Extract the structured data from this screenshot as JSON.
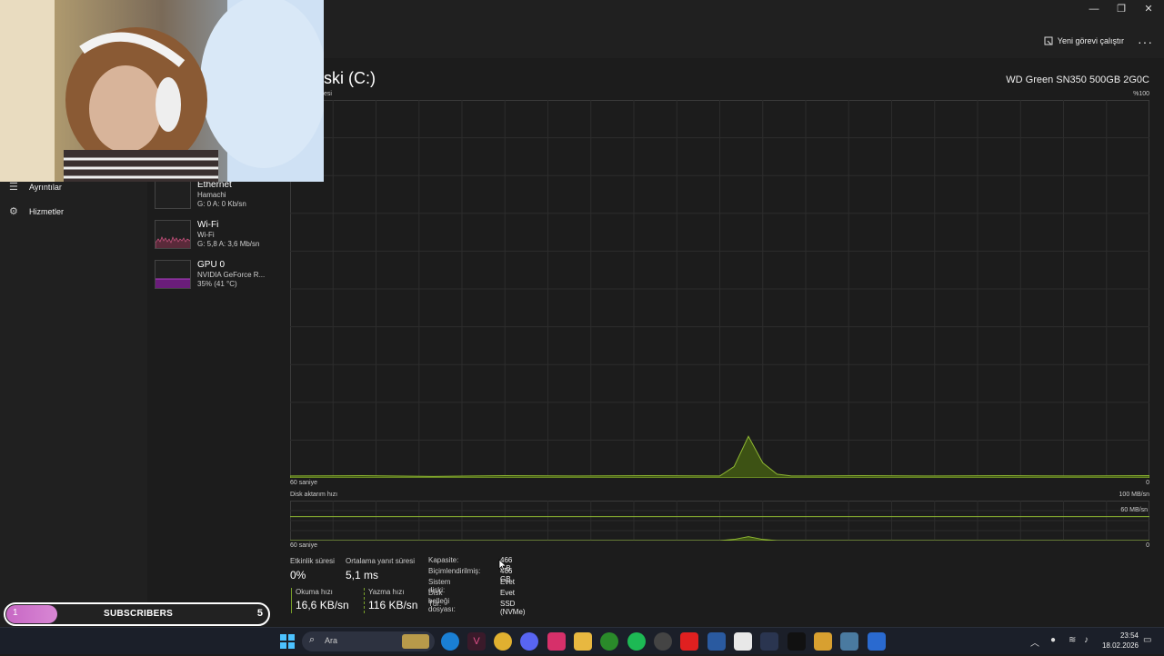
{
  "window": {
    "minimize": "—",
    "maximize": "❐",
    "close": "✕"
  },
  "commandbar": {
    "run_task_label": "Yeni görevi çalıştır",
    "more_label": "···"
  },
  "nav": {
    "items": [
      {
        "label": "Ayrıntılar",
        "icon": "list-icon"
      },
      {
        "label": "Hizmetler",
        "icon": "services-icon"
      }
    ]
  },
  "devices": [
    {
      "name": "Ethernet",
      "sub": "Hamachi",
      "value": "G: 0 A: 0 Kb/sn"
    },
    {
      "name": "Wi-Fi",
      "sub": "Wi-Fi",
      "value": "G: 5,8 A: 3,6 Mb/sn"
    },
    {
      "name": "GPU 0",
      "sub": "NVIDIA GeForce R...",
      "value": "35% (41 °C)"
    }
  ],
  "page": {
    "title": "ski (C:)",
    "model": "WD Green SN350 500GB 2G0C",
    "active_time_label": "esi",
    "max_label": "%100",
    "time_label": "60 saniye",
    "min_label": "0",
    "transfer_label": "Disk aktarım hızı",
    "transfer_max": "100 MB/sn",
    "transfer_line": "60 MB/sn",
    "time_label2": "60 saniye",
    "min_label2": "0"
  },
  "chart_data": [
    {
      "type": "area",
      "title": "",
      "ylabel": "",
      "ylim": [
        0,
        100
      ],
      "x_label": "60 saniye",
      "color": "#8fb832",
      "x": [
        0,
        5,
        10,
        15,
        20,
        25,
        30,
        31,
        32,
        33,
        34,
        35,
        40,
        45,
        50,
        55,
        60
      ],
      "values": [
        0.5,
        0.6,
        0.4,
        0.6,
        0.5,
        0.6,
        0.5,
        3,
        11,
        4,
        1,
        0.5,
        0.6,
        0.5,
        0.6,
        0.5,
        0.6
      ]
    },
    {
      "type": "area",
      "title": "",
      "ylabel": "",
      "ylim": [
        0,
        100
      ],
      "x_label": "60 saniye",
      "color": "#8fb832",
      "reference_line": 60,
      "x": [
        0,
        20,
        30,
        31,
        32,
        33,
        34,
        60
      ],
      "values": [
        0,
        0,
        0,
        3,
        10,
        3,
        0,
        0
      ]
    }
  ],
  "stats": {
    "active_time_label": "Etkinlik süresi",
    "active_time": "0%",
    "avg_response_label": "Ortalama yanıt süresi",
    "avg_response": "5,1 ms",
    "read_label": "Okuma hızı",
    "read_value": "16,6 KB/sn",
    "write_label": "Yazma hızı",
    "write_value": "116 KB/sn"
  },
  "properties": [
    {
      "key": "Kapasite:",
      "value": "466 GB"
    },
    {
      "key": "Biçimlendirilmiş:",
      "value": "466 GB"
    },
    {
      "key": "Sistem diski:",
      "value": "Evet"
    },
    {
      "key": "Disk belleği dosyası:",
      "value": "Evet"
    },
    {
      "key": "Tür:",
      "value": "SSD (NVMe)"
    }
  ],
  "overlay": {
    "sub_count_left": "1",
    "sub_label": "SUBSCRIBERS",
    "sub_count_right": "5"
  },
  "taskbar": {
    "search_placeholder": "Ara",
    "time": "23:54",
    "date": "18.02.2026",
    "apps": [
      "start-icon",
      "weather-icon",
      "edge-icon",
      "app-icon",
      "chrome-icon",
      "discord-icon",
      "instagram-icon",
      "folder-icon",
      "xbox-icon",
      "spotify-icon",
      "app-icon",
      "youtube-icon",
      "mail-icon",
      "notepad-icon",
      "steam-icon",
      "tiktok-icon",
      "app-icon",
      "settings-icon",
      "taskmanager-icon"
    ]
  }
}
